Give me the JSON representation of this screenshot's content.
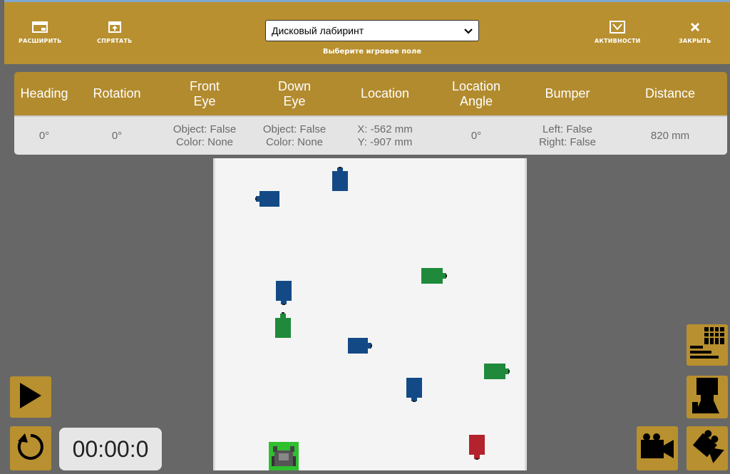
{
  "toolbar": {
    "expand_label": "РАСШИРИТЬ",
    "hide_label": "СПРЯТАТЬ",
    "activities_label": "АКТИВНОСТИ",
    "close_label": "ЗАКРЫТЬ",
    "playfield_select_value": "Дисковый лабиринт",
    "playfield_caption": "Выберите игровое поле"
  },
  "sensors": {
    "headers": [
      "Heading",
      "Rotation",
      "Front\nEye",
      "Down\nEye",
      "Location",
      "Location\nAngle",
      "Bumper",
      "Distance"
    ],
    "values": [
      "0°",
      "0°",
      "Object: False\nColor: None",
      "Object: False\nColor: None",
      "X: -562 mm\nY: -907 mm",
      "0°",
      "Left: False\nRight: False",
      "820 mm"
    ]
  },
  "timer": "00:00:0",
  "colors": {
    "accent": "#b8902f",
    "blue_disk": "#134a86",
    "green_disk": "#1f8a3b",
    "red_disk": "#b3222d",
    "robot": "#2fbf2f"
  },
  "icons": [
    "expand-icon",
    "hide-icon",
    "activities-icon",
    "close-icon",
    "play-icon",
    "reset-icon",
    "data-table-icon",
    "robot-view-icon",
    "camera-icon",
    "top-view-camera-icon"
  ]
}
